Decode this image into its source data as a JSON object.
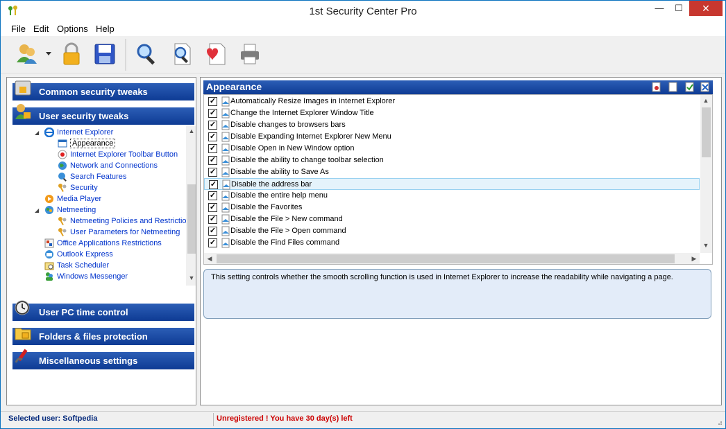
{
  "window": {
    "title": "1st Security Center Pro"
  },
  "window_buttons": {
    "minimize": "—",
    "maximize": "☐",
    "close": "✕"
  },
  "menu": [
    "File",
    "Edit",
    "Options",
    "Help"
  ],
  "toolbar": [
    "users-icon",
    "lock-icon",
    "save-icon",
    "search-icon",
    "search-document-icon",
    "heart-document-icon",
    "printer-icon"
  ],
  "categories": {
    "common": "Common security tweaks",
    "user": "User security tweaks",
    "pc_time": "User PC time control",
    "folders": "Folders & files protection",
    "misc": "Miscellaneous settings"
  },
  "tree": [
    {
      "label": "Internet Explorer",
      "icon": "internet-explorer-icon"
    },
    {
      "label": "Appearance",
      "icon": "window-icon"
    },
    {
      "label": "Internet Explorer Toolbar Button",
      "icon": "record-icon"
    },
    {
      "label": "Network and Connections",
      "icon": "globe-icon"
    },
    {
      "label": "Search Features",
      "icon": "search-globe-icon"
    },
    {
      "label": "Security",
      "icon": "keys-icon"
    },
    {
      "label": "Media Player",
      "icon": "media-player-icon"
    },
    {
      "label": "Netmeeting",
      "icon": "netmeeting-icon"
    },
    {
      "label": "Netmeeting Policies and Restrictio",
      "icon": "keys-icon"
    },
    {
      "label": "User Parameters for Netmeeting",
      "icon": "keys-icon"
    },
    {
      "label": "Office Applications Restrictions",
      "icon": "office-icon"
    },
    {
      "label": "Outlook Express",
      "icon": "outlook-icon"
    },
    {
      "label": "Task Scheduler",
      "icon": "task-scheduler-icon"
    },
    {
      "label": "Windows Messenger",
      "icon": "messenger-icon"
    }
  ],
  "panel": {
    "title": "Appearance"
  },
  "settings": [
    {
      "label": "Automatically Resize Images in Internet Explorer",
      "checked": true
    },
    {
      "label": "Change the Internet Explorer Window Title",
      "checked": true
    },
    {
      "label": "Disable changes to browsers bars",
      "checked": true
    },
    {
      "label": "Disable Expanding Internet Explorer New Menu",
      "checked": true
    },
    {
      "label": "Disable Open in New Window option",
      "checked": true
    },
    {
      "label": "Disable the ability to change toolbar selection",
      "checked": true
    },
    {
      "label": "Disable the ability to Save As",
      "checked": true
    },
    {
      "label": "Disable the address bar",
      "checked": true
    },
    {
      "label": "Disable the entire help menu",
      "checked": true
    },
    {
      "label": "Disable the Favorites",
      "checked": true
    },
    {
      "label": "Disable the File > New command",
      "checked": true
    },
    {
      "label": "Disable the File > Open command",
      "checked": true
    },
    {
      "label": "Disable the Find Files command",
      "checked": true
    }
  ],
  "description": "This setting controls whether the smooth scrolling function is used in Internet Explorer to increase the readability while navigating a page.",
  "status": {
    "user": "Selected user: Softpedia",
    "registration": "Unregistered ! You have 30 day(s) left"
  },
  "colors": {
    "header_blue": "#0e3b94",
    "link_blue": "#0033cc",
    "warning_red": "#cc0000",
    "close_red": "#c7372f"
  }
}
